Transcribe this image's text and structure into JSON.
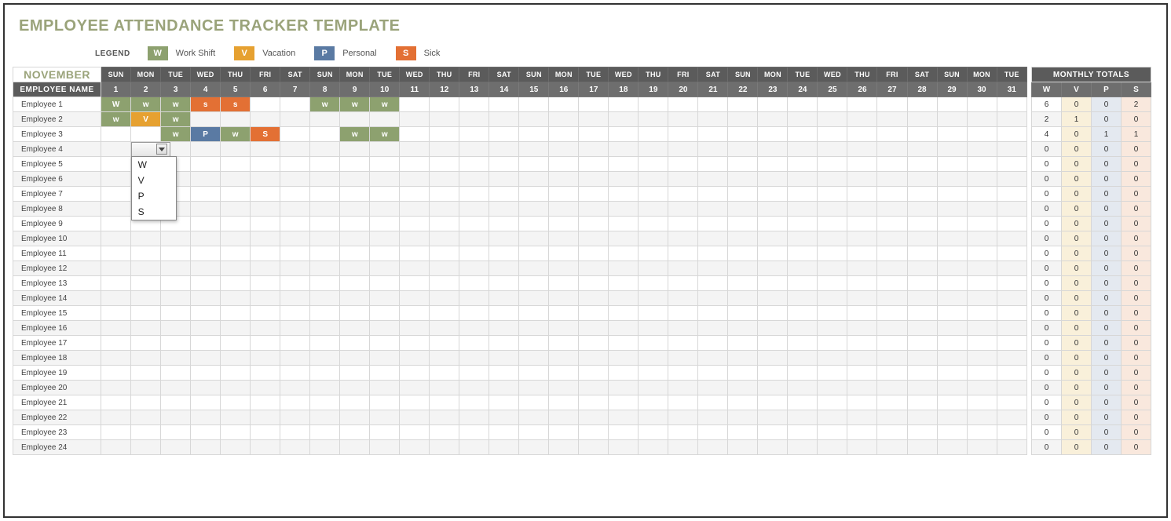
{
  "title": "EMPLOYEE ATTENDANCE TRACKER TEMPLATE",
  "legend": {
    "label": "LEGEND",
    "items": [
      {
        "code": "W",
        "text": "Work Shift",
        "cls": "w"
      },
      {
        "code": "V",
        "text": "Vacation",
        "cls": "v"
      },
      {
        "code": "P",
        "text": "Personal",
        "cls": "p"
      },
      {
        "code": "S",
        "text": "Sick",
        "cls": "s"
      }
    ]
  },
  "month": "NOVEMBER",
  "employee_header": "EMPLOYEE NAME",
  "weekdays": [
    "SUN",
    "MON",
    "TUE",
    "WED",
    "THU",
    "FRI",
    "SAT",
    "SUN",
    "MON",
    "TUE",
    "WED",
    "THU",
    "FRI",
    "SAT",
    "SUN",
    "MON",
    "TUE",
    "WED",
    "THU",
    "FRI",
    "SAT",
    "SUN",
    "MON",
    "TUE",
    "WED",
    "THU",
    "FRI",
    "SAT",
    "SUN",
    "MON",
    "TUE"
  ],
  "dates": [
    "1",
    "2",
    "3",
    "4",
    "5",
    "6",
    "7",
    "8",
    "9",
    "10",
    "11",
    "12",
    "13",
    "14",
    "15",
    "16",
    "17",
    "18",
    "19",
    "20",
    "21",
    "22",
    "23",
    "24",
    "25",
    "26",
    "27",
    "28",
    "29",
    "30",
    "31"
  ],
  "totals_header": "MONTHLY TOTALS",
  "totals_cols": [
    "W",
    "V",
    "P",
    "S"
  ],
  "dropdown": {
    "options": [
      "W",
      "V",
      "P",
      "S"
    ],
    "row_index": 3,
    "col_index": 1
  },
  "employees": [
    {
      "name": "Employee 1",
      "days": [
        "W",
        "w",
        "w",
        "s",
        "s",
        "",
        "",
        "w",
        "w",
        "w",
        "",
        "",
        "",
        "",
        "",
        "",
        "",
        "",
        "",
        "",
        "",
        "",
        "",
        "",
        "",
        "",
        "",
        "",
        "",
        "",
        ""
      ],
      "totals": [
        6,
        0,
        0,
        2
      ]
    },
    {
      "name": "Employee 2",
      "days": [
        "w",
        "V",
        "w",
        "",
        "",
        "",
        "",
        "",
        "",
        "",
        "",
        "",
        "",
        "",
        "",
        "",
        "",
        "",
        "",
        "",
        "",
        "",
        "",
        "",
        "",
        "",
        "",
        "",
        "",
        "",
        ""
      ],
      "totals": [
        2,
        1,
        0,
        0
      ]
    },
    {
      "name": "Employee 3",
      "days": [
        "",
        "",
        "w",
        "P",
        "w",
        "S",
        "",
        "",
        "w",
        "w",
        "",
        "",
        "",
        "",
        "",
        "",
        "",
        "",
        "",
        "",
        "",
        "",
        "",
        "",
        "",
        "",
        "",
        "",
        "",
        "",
        ""
      ],
      "totals": [
        4,
        0,
        1,
        1
      ]
    },
    {
      "name": "Employee 4",
      "days": [
        "",
        "",
        "",
        "",
        "",
        "",
        "",
        "",
        "",
        "",
        "",
        "",
        "",
        "",
        "",
        "",
        "",
        "",
        "",
        "",
        "",
        "",
        "",
        "",
        "",
        "",
        "",
        "",
        "",
        "",
        ""
      ],
      "totals": [
        0,
        0,
        0,
        0
      ]
    },
    {
      "name": "Employee 5",
      "days": [
        "",
        "",
        "",
        "",
        "",
        "",
        "",
        "",
        "",
        "",
        "",
        "",
        "",
        "",
        "",
        "",
        "",
        "",
        "",
        "",
        "",
        "",
        "",
        "",
        "",
        "",
        "",
        "",
        "",
        "",
        ""
      ],
      "totals": [
        0,
        0,
        0,
        0
      ]
    },
    {
      "name": "Employee 6",
      "days": [
        "",
        "",
        "",
        "",
        "",
        "",
        "",
        "",
        "",
        "",
        "",
        "",
        "",
        "",
        "",
        "",
        "",
        "",
        "",
        "",
        "",
        "",
        "",
        "",
        "",
        "",
        "",
        "",
        "",
        "",
        ""
      ],
      "totals": [
        0,
        0,
        0,
        0
      ]
    },
    {
      "name": "Employee 7",
      "days": [
        "",
        "",
        "",
        "",
        "",
        "",
        "",
        "",
        "",
        "",
        "",
        "",
        "",
        "",
        "",
        "",
        "",
        "",
        "",
        "",
        "",
        "",
        "",
        "",
        "",
        "",
        "",
        "",
        "",
        "",
        ""
      ],
      "totals": [
        0,
        0,
        0,
        0
      ]
    },
    {
      "name": "Employee 8",
      "days": [
        "",
        "",
        "",
        "",
        "",
        "",
        "",
        "",
        "",
        "",
        "",
        "",
        "",
        "",
        "",
        "",
        "",
        "",
        "",
        "",
        "",
        "",
        "",
        "",
        "",
        "",
        "",
        "",
        "",
        "",
        ""
      ],
      "totals": [
        0,
        0,
        0,
        0
      ]
    },
    {
      "name": "Employee 9",
      "days": [
        "",
        "",
        "",
        "",
        "",
        "",
        "",
        "",
        "",
        "",
        "",
        "",
        "",
        "",
        "",
        "",
        "",
        "",
        "",
        "",
        "",
        "",
        "",
        "",
        "",
        "",
        "",
        "",
        "",
        "",
        ""
      ],
      "totals": [
        0,
        0,
        0,
        0
      ]
    },
    {
      "name": "Employee 10",
      "days": [
        "",
        "",
        "",
        "",
        "",
        "",
        "",
        "",
        "",
        "",
        "",
        "",
        "",
        "",
        "",
        "",
        "",
        "",
        "",
        "",
        "",
        "",
        "",
        "",
        "",
        "",
        "",
        "",
        "",
        "",
        ""
      ],
      "totals": [
        0,
        0,
        0,
        0
      ]
    },
    {
      "name": "Employee 11",
      "days": [
        "",
        "",
        "",
        "",
        "",
        "",
        "",
        "",
        "",
        "",
        "",
        "",
        "",
        "",
        "",
        "",
        "",
        "",
        "",
        "",
        "",
        "",
        "",
        "",
        "",
        "",
        "",
        "",
        "",
        "",
        ""
      ],
      "totals": [
        0,
        0,
        0,
        0
      ]
    },
    {
      "name": "Employee 12",
      "days": [
        "",
        "",
        "",
        "",
        "",
        "",
        "",
        "",
        "",
        "",
        "",
        "",
        "",
        "",
        "",
        "",
        "",
        "",
        "",
        "",
        "",
        "",
        "",
        "",
        "",
        "",
        "",
        "",
        "",
        "",
        ""
      ],
      "totals": [
        0,
        0,
        0,
        0
      ]
    },
    {
      "name": "Employee 13",
      "days": [
        "",
        "",
        "",
        "",
        "",
        "",
        "",
        "",
        "",
        "",
        "",
        "",
        "",
        "",
        "",
        "",
        "",
        "",
        "",
        "",
        "",
        "",
        "",
        "",
        "",
        "",
        "",
        "",
        "",
        "",
        ""
      ],
      "totals": [
        0,
        0,
        0,
        0
      ]
    },
    {
      "name": "Employee 14",
      "days": [
        "",
        "",
        "",
        "",
        "",
        "",
        "",
        "",
        "",
        "",
        "",
        "",
        "",
        "",
        "",
        "",
        "",
        "",
        "",
        "",
        "",
        "",
        "",
        "",
        "",
        "",
        "",
        "",
        "",
        "",
        ""
      ],
      "totals": [
        0,
        0,
        0,
        0
      ]
    },
    {
      "name": "Employee 15",
      "days": [
        "",
        "",
        "",
        "",
        "",
        "",
        "",
        "",
        "",
        "",
        "",
        "",
        "",
        "",
        "",
        "",
        "",
        "",
        "",
        "",
        "",
        "",
        "",
        "",
        "",
        "",
        "",
        "",
        "",
        "",
        ""
      ],
      "totals": [
        0,
        0,
        0,
        0
      ]
    },
    {
      "name": "Employee 16",
      "days": [
        "",
        "",
        "",
        "",
        "",
        "",
        "",
        "",
        "",
        "",
        "",
        "",
        "",
        "",
        "",
        "",
        "",
        "",
        "",
        "",
        "",
        "",
        "",
        "",
        "",
        "",
        "",
        "",
        "",
        "",
        ""
      ],
      "totals": [
        0,
        0,
        0,
        0
      ]
    },
    {
      "name": "Employee 17",
      "days": [
        "",
        "",
        "",
        "",
        "",
        "",
        "",
        "",
        "",
        "",
        "",
        "",
        "",
        "",
        "",
        "",
        "",
        "",
        "",
        "",
        "",
        "",
        "",
        "",
        "",
        "",
        "",
        "",
        "",
        "",
        ""
      ],
      "totals": [
        0,
        0,
        0,
        0
      ]
    },
    {
      "name": "Employee 18",
      "days": [
        "",
        "",
        "",
        "",
        "",
        "",
        "",
        "",
        "",
        "",
        "",
        "",
        "",
        "",
        "",
        "",
        "",
        "",
        "",
        "",
        "",
        "",
        "",
        "",
        "",
        "",
        "",
        "",
        "",
        "",
        ""
      ],
      "totals": [
        0,
        0,
        0,
        0
      ]
    },
    {
      "name": "Employee 19",
      "days": [
        "",
        "",
        "",
        "",
        "",
        "",
        "",
        "",
        "",
        "",
        "",
        "",
        "",
        "",
        "",
        "",
        "",
        "",
        "",
        "",
        "",
        "",
        "",
        "",
        "",
        "",
        "",
        "",
        "",
        "",
        ""
      ],
      "totals": [
        0,
        0,
        0,
        0
      ]
    },
    {
      "name": "Employee 20",
      "days": [
        "",
        "",
        "",
        "",
        "",
        "",
        "",
        "",
        "",
        "",
        "",
        "",
        "",
        "",
        "",
        "",
        "",
        "",
        "",
        "",
        "",
        "",
        "",
        "",
        "",
        "",
        "",
        "",
        "",
        "",
        ""
      ],
      "totals": [
        0,
        0,
        0,
        0
      ]
    },
    {
      "name": "Employee 21",
      "days": [
        "",
        "",
        "",
        "",
        "",
        "",
        "",
        "",
        "",
        "",
        "",
        "",
        "",
        "",
        "",
        "",
        "",
        "",
        "",
        "",
        "",
        "",
        "",
        "",
        "",
        "",
        "",
        "",
        "",
        "",
        ""
      ],
      "totals": [
        0,
        0,
        0,
        0
      ]
    },
    {
      "name": "Employee 22",
      "days": [
        "",
        "",
        "",
        "",
        "",
        "",
        "",
        "",
        "",
        "",
        "",
        "",
        "",
        "",
        "",
        "",
        "",
        "",
        "",
        "",
        "",
        "",
        "",
        "",
        "",
        "",
        "",
        "",
        "",
        "",
        ""
      ],
      "totals": [
        0,
        0,
        0,
        0
      ]
    },
    {
      "name": "Employee 23",
      "days": [
        "",
        "",
        "",
        "",
        "",
        "",
        "",
        "",
        "",
        "",
        "",
        "",
        "",
        "",
        "",
        "",
        "",
        "",
        "",
        "",
        "",
        "",
        "",
        "",
        "",
        "",
        "",
        "",
        "",
        "",
        ""
      ],
      "totals": [
        0,
        0,
        0,
        0
      ]
    },
    {
      "name": "Employee 24",
      "days": [
        "",
        "",
        "",
        "",
        "",
        "",
        "",
        "",
        "",
        "",
        "",
        "",
        "",
        "",
        "",
        "",
        "",
        "",
        "",
        "",
        "",
        "",
        "",
        "",
        "",
        "",
        "",
        "",
        "",
        "",
        ""
      ],
      "totals": [
        0,
        0,
        0,
        0
      ]
    }
  ]
}
